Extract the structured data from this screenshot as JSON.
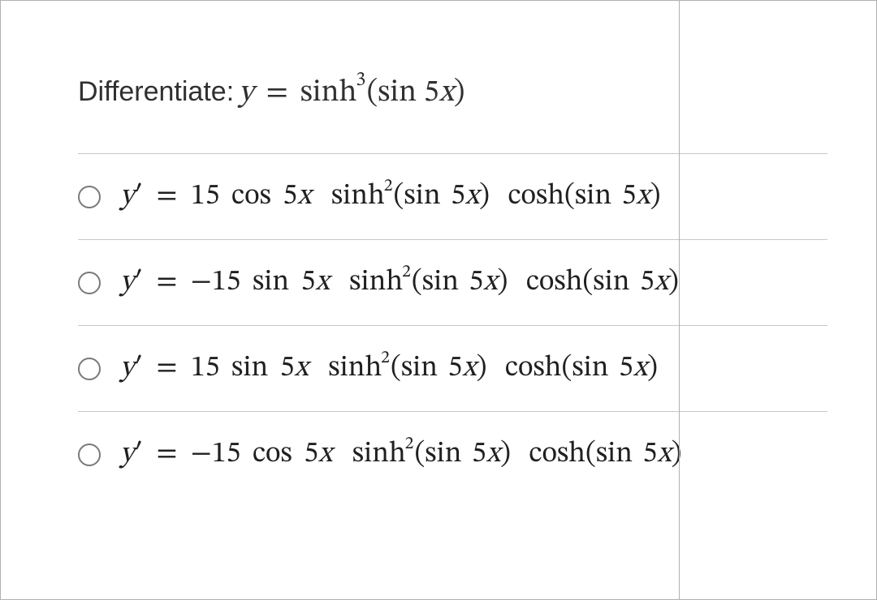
{
  "question": {
    "label": "Differentiate:",
    "expr_y": "y",
    "expr_eq": "=",
    "expr_fn": "sinh",
    "expr_pow": "3",
    "expr_arg_open": "(",
    "expr_arg_sin": "sin",
    "expr_arg_coef": "5",
    "expr_arg_x": "x",
    "expr_arg_close": ")"
  },
  "options": [
    {
      "lhs_y": "y",
      "lhs_prime": "′",
      "eq": "=",
      "coef": "15",
      "trig": "cos",
      "five": "5",
      "x1": "x",
      "sinh": "sinh",
      "pow": "2",
      "arg_open": "(",
      "arg_sin": "sin",
      "arg_five": "5",
      "arg_x": "x",
      "arg_close": ")",
      "cosh": "cosh",
      "arg2_open": "(",
      "arg2_sin": "sin",
      "arg2_five": "5",
      "arg2_x": "x",
      "arg2_close": ")"
    },
    {
      "lhs_y": "y",
      "lhs_prime": "′",
      "eq": "=",
      "coef": "−15",
      "trig": "sin",
      "five": "5",
      "x1": "x",
      "sinh": "sinh",
      "pow": "2",
      "arg_open": "(",
      "arg_sin": "sin",
      "arg_five": "5",
      "arg_x": "x",
      "arg_close": ")",
      "cosh": "cosh",
      "arg2_open": "(",
      "arg2_sin": "sin",
      "arg2_five": "5",
      "arg2_x": "x",
      "arg2_close": ")"
    },
    {
      "lhs_y": "y",
      "lhs_prime": "′",
      "eq": "=",
      "coef": "15",
      "trig": "sin",
      "five": "5",
      "x1": "x",
      "sinh": "sinh",
      "pow": "2",
      "arg_open": "(",
      "arg_sin": "sin",
      "arg_five": "5",
      "arg_x": "x",
      "arg_close": ")",
      "cosh": "cosh",
      "arg2_open": "(",
      "arg2_sin": "sin",
      "arg2_five": "5",
      "arg2_x": "x",
      "arg2_close": ")"
    },
    {
      "lhs_y": "y",
      "lhs_prime": "′",
      "eq": "=",
      "coef": "−15",
      "trig": "cos",
      "five": "5",
      "x1": "x",
      "sinh": "sinh",
      "pow": "2",
      "arg_open": "(",
      "arg_sin": "sin",
      "arg_five": "5",
      "arg_x": "x",
      "arg_close": ")",
      "cosh": "cosh",
      "arg2_open": "(",
      "arg2_sin": "sin",
      "arg2_five": "5",
      "arg2_x": "x",
      "arg2_close": ")"
    }
  ]
}
